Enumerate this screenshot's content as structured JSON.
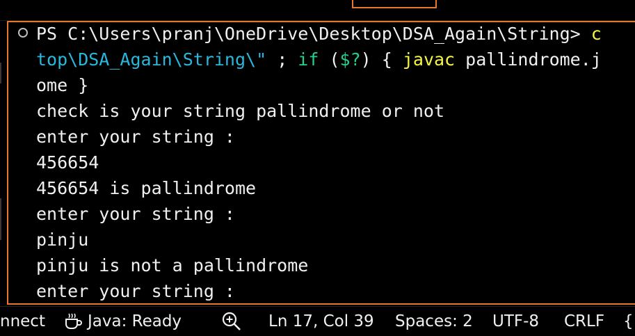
{
  "terminal": {
    "lines": [
      [
        {
          "t": "PS C:\\Users\\pranj\\OneDrive\\Desktop\\DSA_Again\\String> ",
          "c": ""
        },
        {
          "t": "c",
          "c": "yellow"
        }
      ],
      [
        {
          "t": "top\\DSA_Again\\String\\\"",
          "c": "cyan"
        },
        {
          "t": " ; ",
          "c": ""
        },
        {
          "t": "if",
          "c": "green"
        },
        {
          "t": " (",
          "c": ""
        },
        {
          "t": "$?",
          "c": "green"
        },
        {
          "t": ") { ",
          "c": ""
        },
        {
          "t": "javac",
          "c": "yellow"
        },
        {
          "t": " pallindrome.j",
          "c": ""
        }
      ],
      [
        {
          "t": "ome }",
          "c": ""
        }
      ],
      [
        {
          "t": "check is your string pallindrome or not",
          "c": ""
        }
      ],
      [
        {
          "t": "enter your string :",
          "c": ""
        }
      ],
      [
        {
          "t": "456654",
          "c": ""
        }
      ],
      [
        {
          "t": "456654 is pallindrome",
          "c": ""
        }
      ],
      [
        {
          "t": "enter your string :",
          "c": ""
        }
      ],
      [
        {
          "t": "pinju",
          "c": ""
        }
      ],
      [
        {
          "t": "pinju is not a pallindrome",
          "c": ""
        }
      ],
      [
        {
          "t": "enter your string :",
          "c": ""
        }
      ]
    ]
  },
  "statusbar": {
    "connect": "nnect",
    "java_status": "Java: Ready",
    "zoom_icon": "zoom-in-icon",
    "java_icon": "coffee-icon",
    "cursor_position": "Ln 17, Col 39",
    "indentation": "Spaces: 2",
    "encoding": "UTF-8",
    "line_ending": "CRLF",
    "language_brace": "{"
  },
  "colors": {
    "border_accent": "#e8772e",
    "cyan": "#29b8db",
    "green": "#23d18b",
    "yellow": "#f5f543",
    "text": "#f0f0f0",
    "background": "#000000"
  }
}
